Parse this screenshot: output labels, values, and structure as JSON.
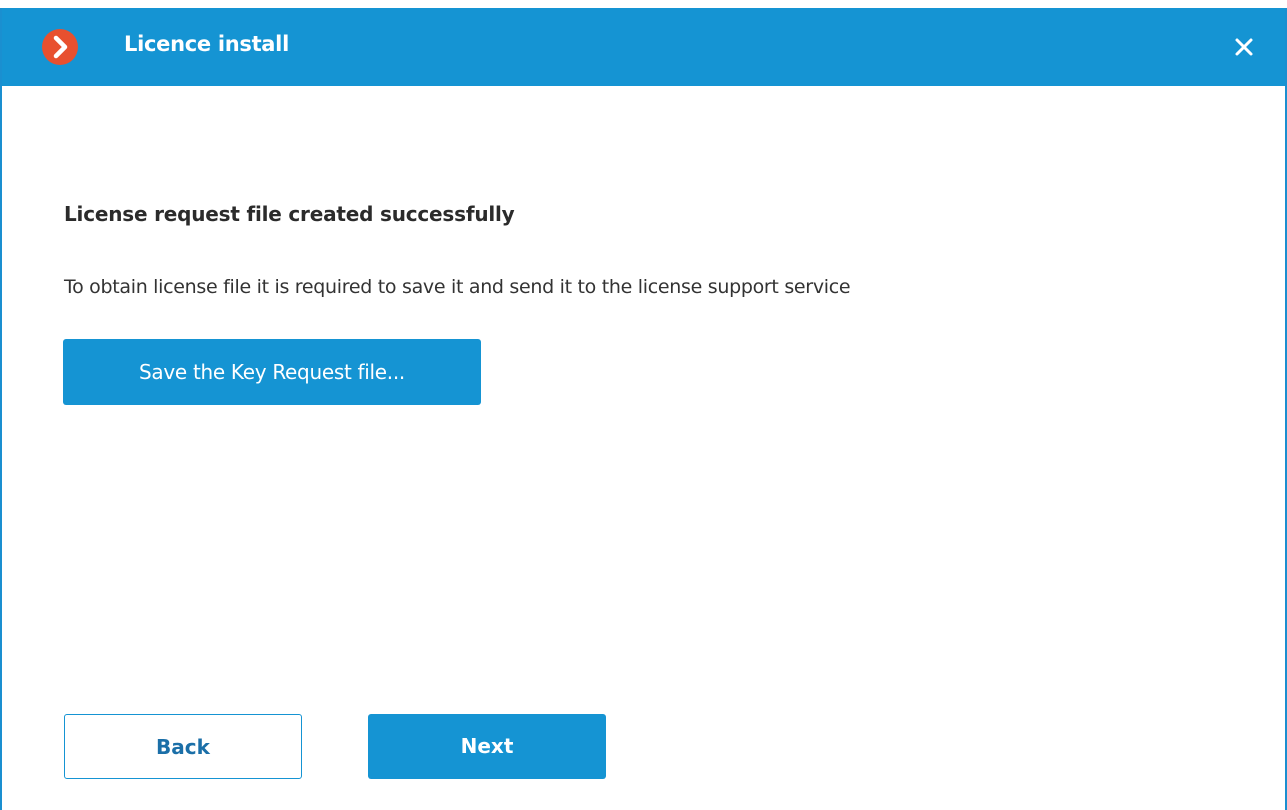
{
  "window": {
    "title": "Licence install",
    "logo_icon": "chevron-right-logo-icon",
    "close_icon": "close-icon"
  },
  "content": {
    "heading": "License request file created successfully",
    "description": "To obtain license file it is required to save it and send it to the license support service",
    "save_button_label": "Save the Key Request file..."
  },
  "footer": {
    "back_label": "Back",
    "next_label": "Next"
  },
  "colors": {
    "accent": "#1594d3",
    "logo": "#e8502f",
    "text": "#2b2b2b"
  }
}
